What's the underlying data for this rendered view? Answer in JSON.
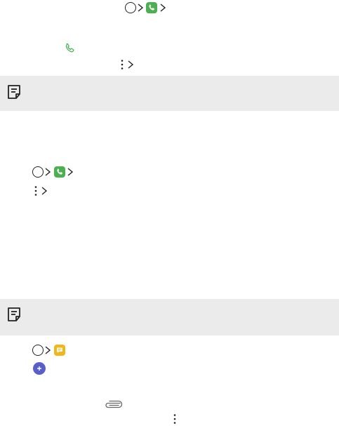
{
  "colors": {
    "phone_app": "#4caf50",
    "phone_outline": "#3aa847",
    "message_app": "#f2b51c",
    "fab": "#5a5fc8",
    "note_bg": "#ebebeb",
    "text": "#222222"
  },
  "icons": {
    "home": "home-button-icon",
    "arrow": "chevron-right-icon",
    "phone_app": "phone-app-icon",
    "phone_outline": "phone-outline-icon",
    "more": "more-options-icon",
    "note": "note-icon",
    "message_app": "message-app-icon",
    "add": "plus-icon",
    "attach": "paperclip-icon"
  }
}
